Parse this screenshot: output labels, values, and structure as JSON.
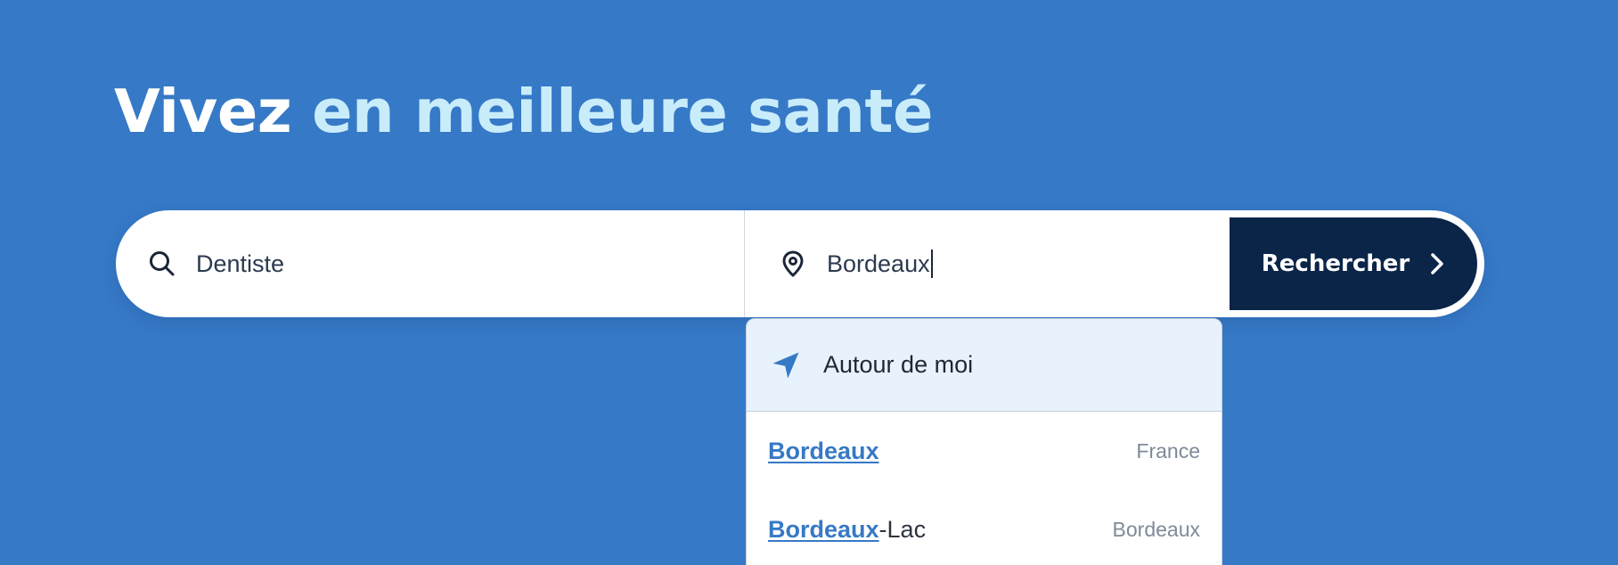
{
  "hero": {
    "title_part1": "Vivez",
    "title_part2": "en meilleure santé"
  },
  "search": {
    "speciality_value": "Dentiste",
    "speciality_icon": "search-icon",
    "location_value": "Bordeaux",
    "location_icon": "map-pin-icon",
    "button_label": "Rechercher",
    "button_icon": "chevron-right-icon"
  },
  "dropdown": {
    "near_me_label": "Autour de moi",
    "near_me_icon": "navigation-arrow-icon",
    "suggestions": [
      {
        "match": "Bordeaux",
        "rest": "",
        "meta": "France"
      },
      {
        "match": "Bordeaux",
        "rest": "-Lac",
        "meta": "Bordeaux"
      }
    ]
  },
  "colors": {
    "background": "#3679c6",
    "accent_light": "#c9ecfb",
    "button": "#0b2549",
    "link": "#3679c6",
    "near_me_bg": "#e7f2fc"
  }
}
